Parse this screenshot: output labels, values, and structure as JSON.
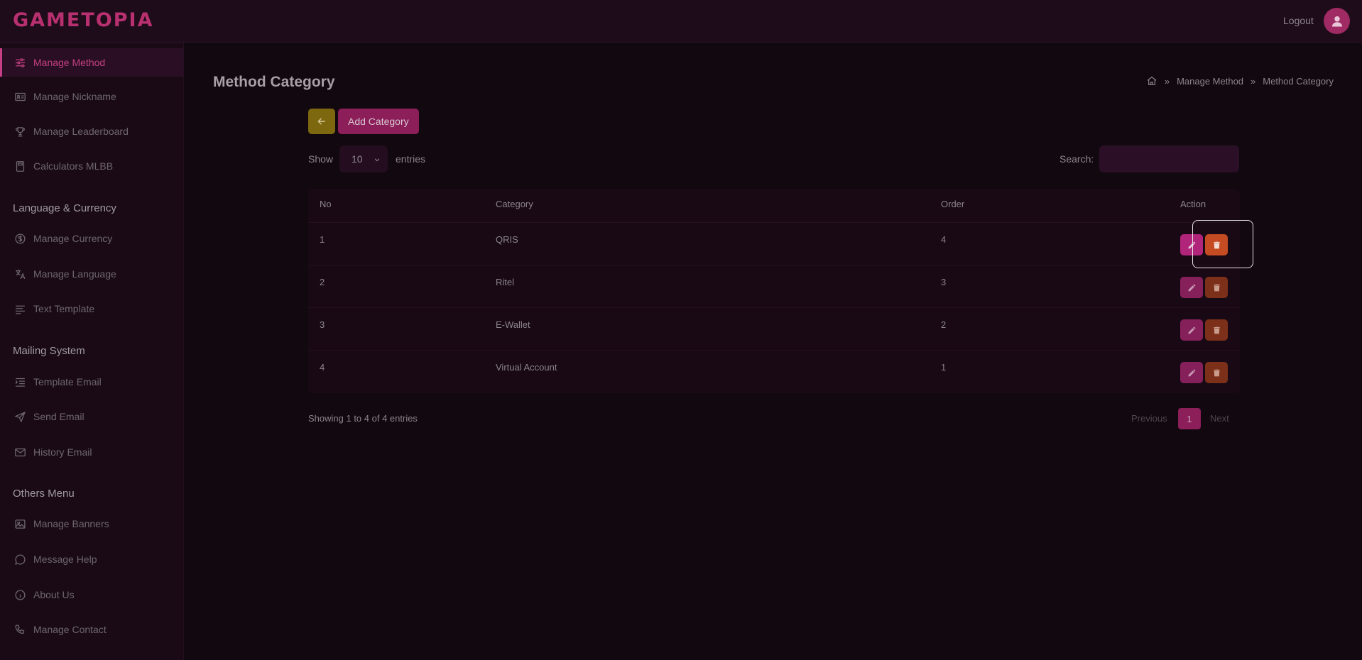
{
  "app": {
    "logo": "GAMETOPIA",
    "logout": "Logout"
  },
  "sidebar": {
    "items": [
      {
        "label": "Manage Method",
        "icon": "sliders-icon"
      },
      {
        "label": "Manage Nickname",
        "icon": "id-card-icon"
      },
      {
        "label": "Manage Leaderboard",
        "icon": "trophy-icon"
      },
      {
        "label": "Calculators MLBB",
        "icon": "calculator-icon"
      },
      {
        "label": "Manage Currency",
        "icon": "dollar-icon"
      },
      {
        "label": "Manage Language",
        "icon": "translate-icon"
      },
      {
        "label": "Text Template",
        "icon": "text-lines-icon"
      },
      {
        "label": "Template Email",
        "icon": "list-indent-icon"
      },
      {
        "label": "Send Email",
        "icon": "send-icon"
      },
      {
        "label": "History Email",
        "icon": "mail-icon"
      },
      {
        "label": "Manage Banners",
        "icon": "image-icon"
      },
      {
        "label": "Message Help",
        "icon": "chat-icon"
      },
      {
        "label": "About Us",
        "icon": "info-icon"
      },
      {
        "label": "Manage Contact",
        "icon": "phone-icon"
      }
    ],
    "sections": [
      "Language & Currency",
      "Mailing System",
      "Others Menu"
    ],
    "active_index": 0
  },
  "page": {
    "title": "Method Category",
    "breadcrumb": [
      "Manage Method",
      "Method Category"
    ]
  },
  "toolbar": {
    "add_label": "Add Category"
  },
  "table_controls": {
    "show_label": "Show",
    "entries_value": "10",
    "entries_label": "entries",
    "search_label": "Search:",
    "search_value": ""
  },
  "table": {
    "headers": [
      "No",
      "Category",
      "Order",
      "Action"
    ],
    "rows": [
      {
        "no": "1",
        "category": "QRIS",
        "order": "4"
      },
      {
        "no": "2",
        "category": "Ritel",
        "order": "3"
      },
      {
        "no": "3",
        "category": "E-Wallet",
        "order": "2"
      },
      {
        "no": "4",
        "category": "Virtual Account",
        "order": "1"
      }
    ]
  },
  "pagination": {
    "info": "Showing 1 to 4 of 4 entries",
    "previous": "Previous",
    "current": "1",
    "next": "Next"
  },
  "colors": {
    "accent": "#c43f83",
    "edit_button": "#86205a",
    "delete_button": "#7c3019",
    "back_button": "#7d6810"
  }
}
